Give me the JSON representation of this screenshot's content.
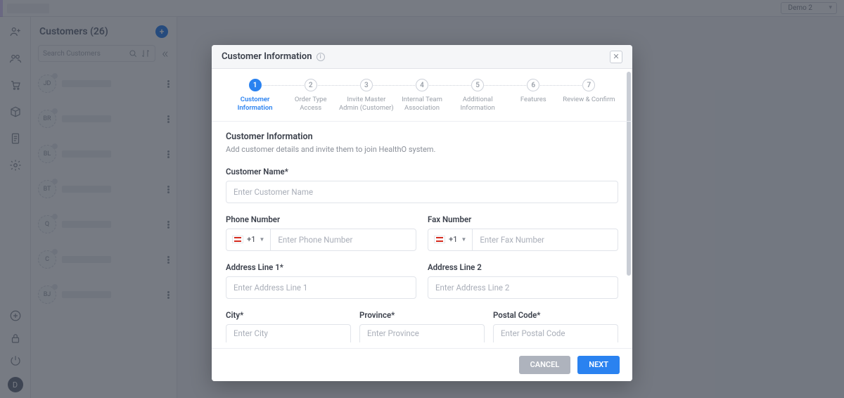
{
  "topbar": {
    "demo_label": "Demo 2"
  },
  "sidebar": {
    "title": "Customers (26)",
    "search_placeholder": "Search Customers",
    "items": [
      {
        "initials": "JD"
      },
      {
        "initials": "BR"
      },
      {
        "initials": "BL"
      },
      {
        "initials": "BT"
      },
      {
        "initials": "Q"
      },
      {
        "initials": "C"
      },
      {
        "initials": "BJ"
      }
    ],
    "avatar_initial": "D"
  },
  "modal": {
    "title": "Customer Information",
    "steps": [
      {
        "num": "1",
        "label": "Customer Information"
      },
      {
        "num": "2",
        "label": "Order Type Access"
      },
      {
        "num": "3",
        "label": "Invite Master Admin (Customer)"
      },
      {
        "num": "4",
        "label": "Internal Team Association"
      },
      {
        "num": "5",
        "label": "Additional Information"
      },
      {
        "num": "6",
        "label": "Features"
      },
      {
        "num": "7",
        "label": "Review & Confirm"
      }
    ],
    "section_title": "Customer Information",
    "section_desc": "Add customer details and invite them to join HealthO system.",
    "labels": {
      "customer_name": "Customer Name*",
      "phone": "Phone Number",
      "fax": "Fax Number",
      "addr1": "Address Line 1*",
      "addr2": "Address Line 2",
      "city": "City*",
      "province": "Province*",
      "postal": "Postal Code*"
    },
    "placeholders": {
      "customer_name": "Enter Customer Name",
      "phone": "Enter Phone Number",
      "fax": "Enter Fax Number",
      "addr1": "Enter Address Line 1",
      "addr2": "Enter Address Line 2",
      "city": "Enter City",
      "province": "Enter Province",
      "postal": "Enter Postal Code"
    },
    "country_code": "+1",
    "buttons": {
      "cancel": "CANCEL",
      "next": "NEXT"
    }
  }
}
